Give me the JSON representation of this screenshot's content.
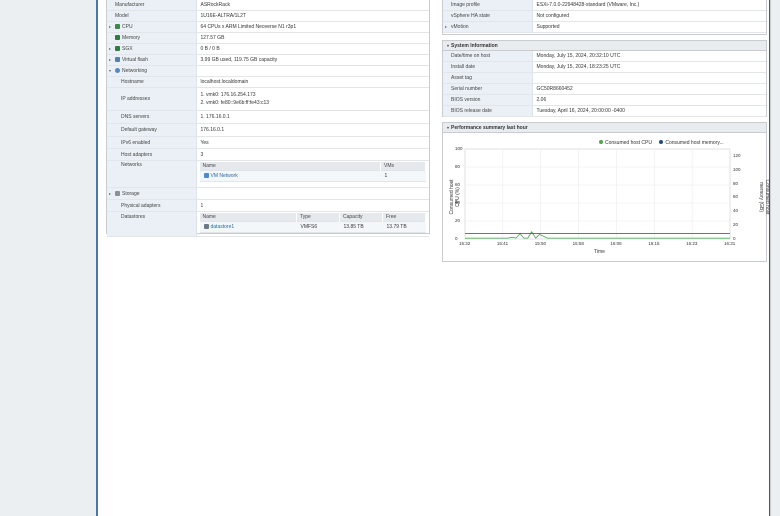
{
  "hardware": {
    "rows": [
      {
        "key": "Manufacturer",
        "value": "ASRockRack",
        "expander": "",
        "icon": ""
      },
      {
        "key": "Model",
        "value": "1U16E-ALTRA/1L2T",
        "expander": "",
        "icon": ""
      },
      {
        "key": "CPU",
        "value": "64 CPUs x ARM Limited Neoverse N1 r3p1",
        "expander": "▸",
        "icon": "cpu-icon"
      },
      {
        "key": "Memory",
        "value": "127.57 GB",
        "expander": "",
        "icon": "memory-icon"
      },
      {
        "key": "SGX",
        "value": "0 B / 0 B",
        "expander": "▸",
        "icon": "sgx-icon"
      },
      {
        "key": "Virtual flash",
        "value": "3.99 GB used, 119.75 GB capacity",
        "expander": "▸",
        "icon": "flash-icon"
      },
      {
        "key": "Networking",
        "value": "",
        "expander": "▾",
        "icon": "networking-icon"
      },
      {
        "key": "Hostname",
        "value": "localhost.localdomain",
        "expander": "",
        "icon": ""
      }
    ],
    "ip_label": "IP addresses",
    "ip_values": [
      "1. vmk0: 176.16.254.173",
      "2. vmk0: fe80::9e6b:ff:fe43:c13"
    ],
    "rows2": [
      {
        "key": "DNS servers",
        "value": "1. 176.16.0.1"
      },
      {
        "key": "Default gateway",
        "value": "176.16.0.1"
      },
      {
        "key": "IPv6 enabled",
        "value": "Yes"
      },
      {
        "key": "Host adapters",
        "value": "3"
      }
    ],
    "networks_label": "Networks",
    "networks_cols": [
      "Name",
      "VMs"
    ],
    "networks_rows": [
      {
        "name": "VM Network",
        "vms": "1"
      }
    ],
    "storage_label": "Storage",
    "phys_label": "Physical adapters",
    "phys_value": "1",
    "datastores_label": "Datastores",
    "ds_cols": [
      "Name",
      "Type",
      "Capacity",
      "Free"
    ],
    "ds_rows": [
      {
        "name": "datastore1",
        "type": "VMFS6",
        "capacity": "13.85 TB",
        "free": "13.79 TB"
      }
    ]
  },
  "config": {
    "rows": [
      {
        "key": "Image profile",
        "value": "ESXi-7.0.0-22948428-standard (VMware, Inc.)",
        "expander": ""
      },
      {
        "key": "vSphere HA state",
        "value": "Not configured",
        "expander": ""
      },
      {
        "key": "vMotion",
        "value": "Supported",
        "expander": "▸"
      }
    ]
  },
  "system_info": {
    "title": "System Information",
    "rows": [
      {
        "key": "Date/time on host",
        "value": "Monday, July 15, 2024, 20:32:10 UTC"
      },
      {
        "key": "Install date",
        "value": "Monday, July 15, 2024, 18:23:25 UTC"
      },
      {
        "key": "Asset tag",
        "value": ""
      },
      {
        "key": "Serial number",
        "value": "GC50R8660452"
      },
      {
        "key": "BIOS version",
        "value": "2.06"
      },
      {
        "key": "BIOS release date",
        "value": "Tuesday, April 16, 2024, 20:00:00 -0400"
      }
    ]
  },
  "performance": {
    "title": "Performance summary last hour"
  },
  "chart_data": {
    "type": "line",
    "xlabel": "Time",
    "ylabel": "Consumed host CPU (%)",
    "y2label": "Consumed host memory (GB)",
    "x_ticks": [
      "15:32",
      "15:41",
      "15:50",
      "15:58",
      "16:06",
      "16:15",
      "16:23",
      "16:31"
    ],
    "y_ticks": [
      "0",
      "20",
      "40",
      "60",
      "80",
      "100"
    ],
    "y2_ticks": [
      "0",
      "20",
      "40",
      "60",
      "80",
      "100",
      "120"
    ],
    "ylim": [
      0,
      100
    ],
    "y2lim": [
      0,
      130
    ],
    "series": [
      {
        "name": "Consumed host CPU",
        "axis": "left",
        "color": "#4aa84a",
        "x": [
          0,
          8,
          16,
          20,
          26,
          40,
          44,
          48,
          52,
          56,
          60,
          64,
          68,
          72,
          76,
          84,
          96,
          110,
          130,
          150,
          170,
          190,
          210,
          230,
          250,
          270
        ],
        "y": [
          1,
          1,
          1,
          1,
          1,
          1,
          1,
          2,
          1,
          6,
          1,
          1,
          8,
          1,
          5,
          1,
          1,
          1,
          1,
          1,
          1,
          1,
          1,
          1,
          1,
          1
        ]
      },
      {
        "name": "Consumed host memory...",
        "axis": "right",
        "color": "#1f4f7a",
        "x": [
          0,
          270
        ],
        "y": [
          8,
          8
        ]
      }
    ]
  },
  "colors": {
    "accent": "#2a69a8",
    "panel_header": "#e9ecef",
    "key_bg": "#eaf0f5"
  }
}
